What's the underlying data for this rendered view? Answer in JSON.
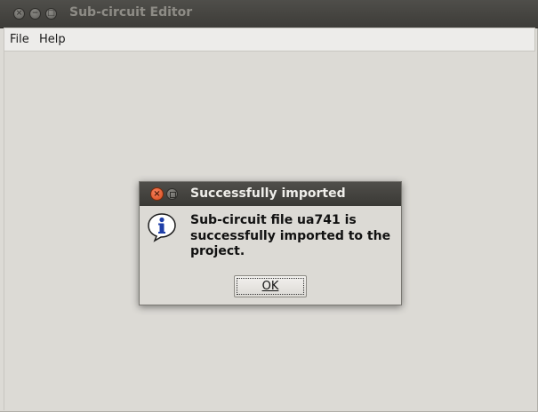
{
  "window": {
    "title": "Sub-circuit Editor",
    "controls": [
      "close",
      "minimize",
      "maximize"
    ]
  },
  "menubar": {
    "items": [
      {
        "label": "File"
      },
      {
        "label": "Help"
      }
    ]
  },
  "dialog": {
    "title": "Successfully imported",
    "icon": "info-icon",
    "message": "Sub-circuit file ua741 is successfully imported to the project.",
    "ok_label": "OK"
  },
  "colors": {
    "titlebar": "#3d3c38",
    "window_bg": "#dcdad5",
    "close_button": "#e25a2a"
  }
}
